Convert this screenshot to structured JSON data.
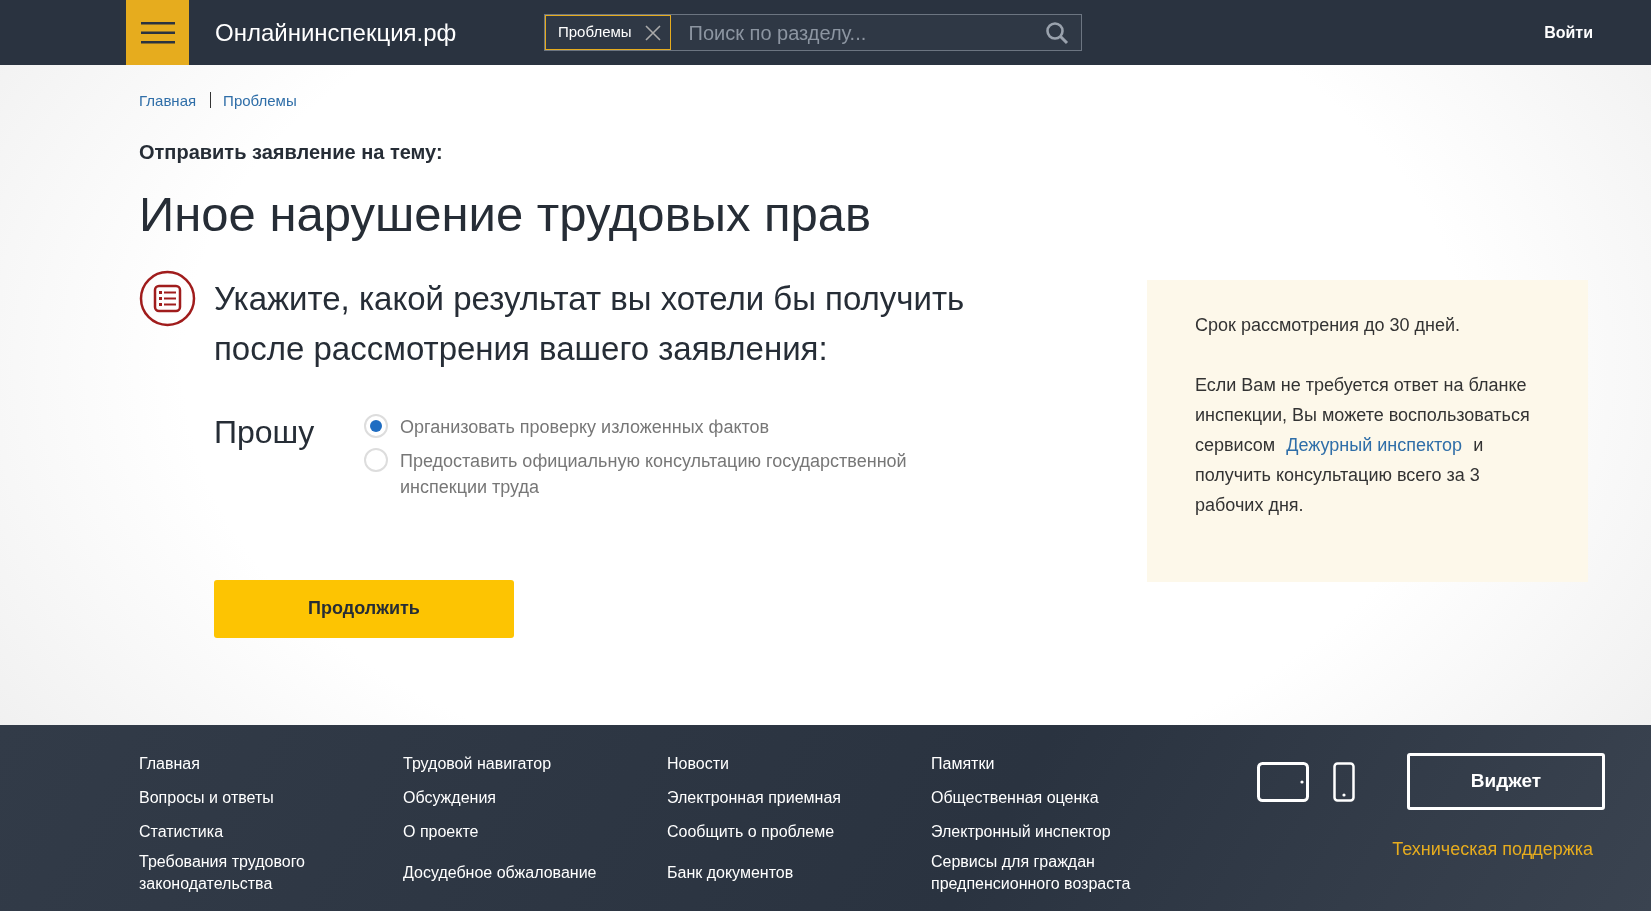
{
  "header": {
    "site_title": "Онлайнинспекция.рф",
    "search": {
      "tag": "Проблемы",
      "placeholder": "Поиск по разделу..."
    },
    "login": "Войти"
  },
  "breadcrumbs": [
    "Главная",
    "Проблемы"
  ],
  "subtitle": "Отправить заявление на тему:",
  "title": "Иное нарушение трудовых прав",
  "question": "Укажите, какой результат вы хотели бы получить после рассмотрения вашего заявления:",
  "request_label": "Прошу",
  "options": [
    {
      "label": "Организовать проверку изложенных фактов",
      "selected": true
    },
    {
      "label": "Предоставить официальную консультацию государственной инспекции труда",
      "selected": false
    }
  ],
  "continue_button": "Продолжить",
  "info": {
    "term": "Срок рассмотрения до 30 дней.",
    "text_before": "Если Вам не требуется ответ на бланке инспекции, Вы можете воспользоваться сервисом",
    "link": "Дежурный инспектор",
    "text_after": "и получить консультацию всего за 3 рабочих дня."
  },
  "footer": {
    "columns": [
      [
        "Главная",
        "Вопросы и ответы",
        "Статистика",
        "Требования трудового законодательства"
      ],
      [
        "Трудовой навигатор",
        "Обсуждения",
        "О проекте",
        "Досудебное обжалование"
      ],
      [
        "Новости",
        "Электронная приемная",
        "Сообщить о проблеме",
        "Банк документов"
      ],
      [
        "Памятки",
        "Общественная оценка",
        "Электронный инспектор",
        "Сервисы для граждан предпенсионного возраста"
      ]
    ],
    "widget_button": "Виджет",
    "support_link": "Техническая поддержка"
  }
}
